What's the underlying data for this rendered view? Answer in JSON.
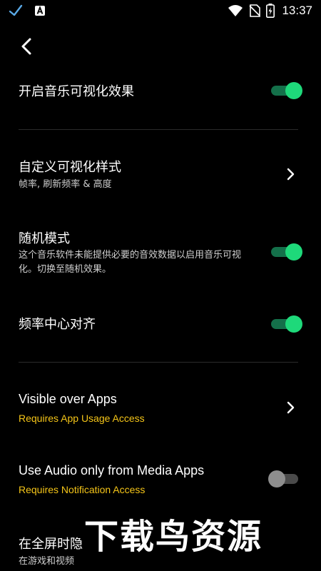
{
  "status_bar": {
    "time": "13:37",
    "left_icons": [
      "check-icon",
      "app-a-icon"
    ],
    "right_icons": [
      "wifi-icon",
      "no-sim-icon",
      "battery-charging-icon"
    ]
  },
  "header": {
    "back_icon": "chevron-left-icon"
  },
  "settings": {
    "visualizer_enable": {
      "title": "开启音乐可视化效果",
      "enabled": true
    },
    "custom_style": {
      "title": "自定义可视化样式",
      "subtitle": "帧率, 刷新频率 & 高度"
    },
    "random_mode": {
      "title": "随机模式",
      "subtitle": "这个音乐软件未能提供必要的音效数据以启用音乐可视化。切换至随机效果。",
      "enabled": true
    },
    "freq_center": {
      "title": "频率中心对齐",
      "enabled": true
    },
    "visible_over_apps": {
      "title": "Visible over Apps",
      "subtitle": "Requires App Usage Access"
    },
    "media_audio_only": {
      "title": "Use Audio only from Media Apps",
      "subtitle": "Requires Notification Access",
      "enabled": false
    },
    "fullscreen_hide": {
      "title": "在全屏时隐",
      "subtitle": "在游戏和视频"
    }
  },
  "watermark": {
    "text": "下载鸟资源"
  },
  "colors": {
    "background": "#000000",
    "accent_green": "#1ed97a",
    "warning_yellow": "#f5c518"
  }
}
